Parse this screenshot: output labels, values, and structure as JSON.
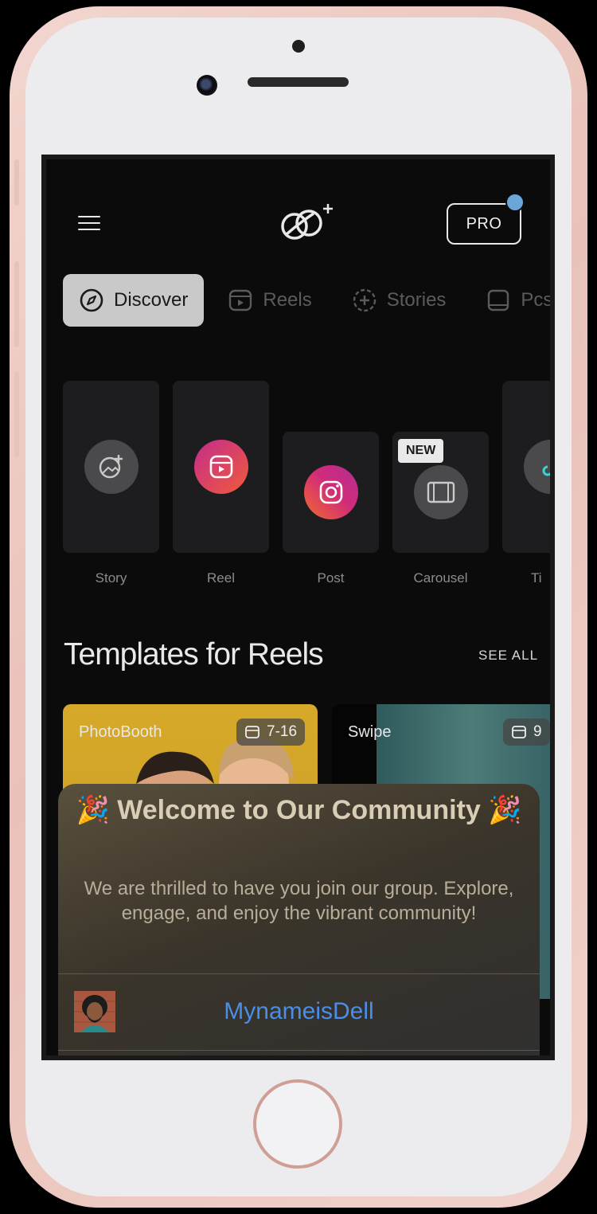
{
  "header": {
    "pro_label": "PRO"
  },
  "tabs": [
    {
      "label": "Discover",
      "icon": "compass-icon"
    },
    {
      "label": "Reels",
      "icon": "reels-icon"
    },
    {
      "label": "Stories",
      "icon": "stories-plus-icon"
    },
    {
      "label": "Pcs",
      "icon": "post-square-icon"
    }
  ],
  "create_options": [
    {
      "label": "Story",
      "icon": "image-plus-icon"
    },
    {
      "label": "Reel",
      "icon": "instagram-reels-icon"
    },
    {
      "label": "Post",
      "icon": "instagram-icon"
    },
    {
      "label": "Carousel",
      "icon": "film-frame-icon",
      "badge": "NEW"
    },
    {
      "label": "Ti",
      "icon": "tiktok-icon"
    }
  ],
  "templates_section": {
    "title": "Templates for Reels",
    "see_all": "SEE ALL",
    "items": [
      {
        "name": "PhotoBooth",
        "count": "7-16"
      },
      {
        "name": "Swipe",
        "count": "9"
      }
    ]
  },
  "welcome_dialog": {
    "title": "🎉 Welcome to Our Community 🎉",
    "body": "We are thrilled to have you join our group. Explore, engage, and enjoy the vibrant community!",
    "username": "MynameisDell"
  },
  "colors": {
    "accent_blue": "#4b8ee8",
    "pro_dot": "#6aa7d8",
    "reel_gradient_start": "#e0317a",
    "reel_gradient_end": "#f26b2b"
  }
}
